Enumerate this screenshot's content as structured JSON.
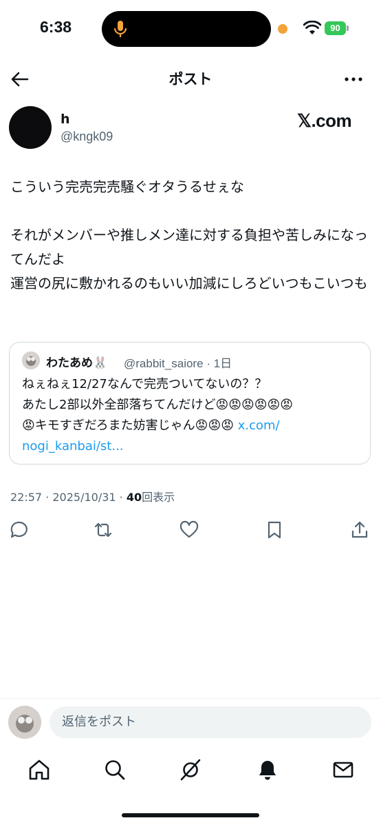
{
  "status": {
    "time": "6:38",
    "battery": "90"
  },
  "header": {
    "title": "ポスト"
  },
  "post": {
    "author_name": "h",
    "author_handle": "@kngk09",
    "brand": "𝕏.com",
    "text": "こういう完売完売騒ぐオタうるせぇな\n\nそれがメンバーや推しメン達に対する負担や苦しみになってんだよ\n運営の尻に敷かれるのもいい加減にしろどいつもこいつも",
    "timestamp": "22:57 · 2025/10/31 · ",
    "views_count": "40",
    "views_label": "回表示"
  },
  "quote": {
    "author_name": "わたあめ🐰",
    "author_handle": "@rabbit_saiore · 1日",
    "text": "ねぇねぇ12/27なんで完売ついてないの？？\nあたし2部以外全部落ちてんだけど😡😡😡😡😡😡\n😡キモすぎだろまた妨害じゃん😡😡😡 ",
    "link": "x.com/\nnogi_kanbai/st..."
  },
  "reply": {
    "placeholder": "返信をポスト"
  },
  "colors": {
    "link": "#1d9bf0",
    "secondary_text": "#536471",
    "battery": "#34c759",
    "record_dot": "#f3a33a"
  },
  "icons": {
    "actions": [
      "reply-icon",
      "repost-icon",
      "like-icon",
      "bookmark-icon",
      "share-icon"
    ],
    "nav": [
      "home-icon",
      "search-icon",
      "grok-icon",
      "notifications-icon",
      "messages-icon"
    ]
  }
}
